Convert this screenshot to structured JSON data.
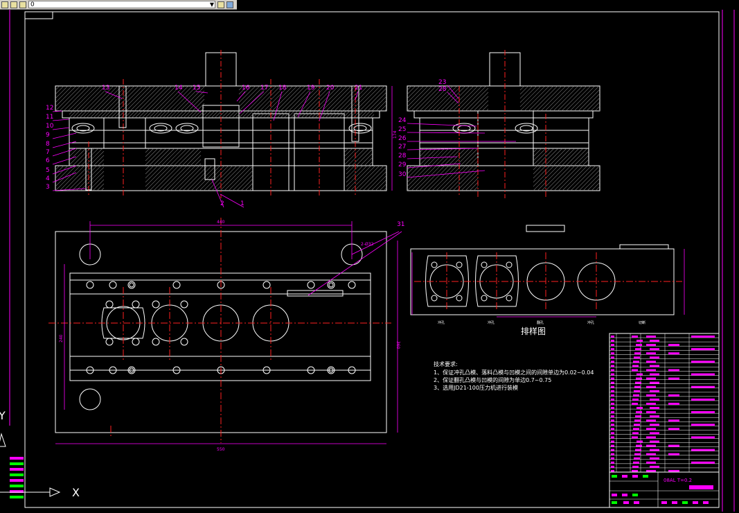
{
  "toolbar": {
    "layer_value": "0",
    "icons": [
      "sun-icon",
      "lock-icon",
      "color-square-icon",
      "layer-manager-icon",
      "layer-previous-icon"
    ]
  },
  "drawing": {
    "dimension_text": {
      "top_width": "440",
      "bottom_width": "550",
      "left_height": "240",
      "right_height": "360",
      "side_height": "174",
      "hole_callout": "2-Ø32"
    },
    "part_labels_front": [
      "1",
      "2",
      "3",
      "4",
      "5",
      "6",
      "7",
      "8",
      "9",
      "10",
      "11",
      "12",
      "13",
      "14",
      "15",
      "16",
      "17",
      "18",
      "19",
      "20",
      "21"
    ],
    "part_labels_side": [
      "23",
      "28",
      "24",
      "25",
      "26",
      "27",
      "28",
      "29",
      "30"
    ],
    "leader_31": "31",
    "strip_title": "排样图",
    "strip_steps": [
      "冲孔",
      "冲孔",
      "翻孔",
      "冲孔",
      "切断"
    ],
    "tech_req": {
      "title": "技术要求:",
      "items": [
        "1、保证冲孔凸模、落料凸模与凹模之间的间隙单边为0.02~0.04",
        "2、保证翻孔凸模与凹模的间隙为单边0.7~0.75",
        "3、选用JD21-100压力机进行装模"
      ]
    },
    "title_block": {
      "material": "08AL T=0.2"
    }
  },
  "ucs": {
    "x_label": "X",
    "y_label": "Y"
  },
  "colors": {
    "background": "#000000",
    "outline": "#ffffff",
    "centerline": "#ff2020",
    "dimension": "#ff00ff",
    "annotation": "#ff00ff",
    "green": "#00ff00"
  }
}
